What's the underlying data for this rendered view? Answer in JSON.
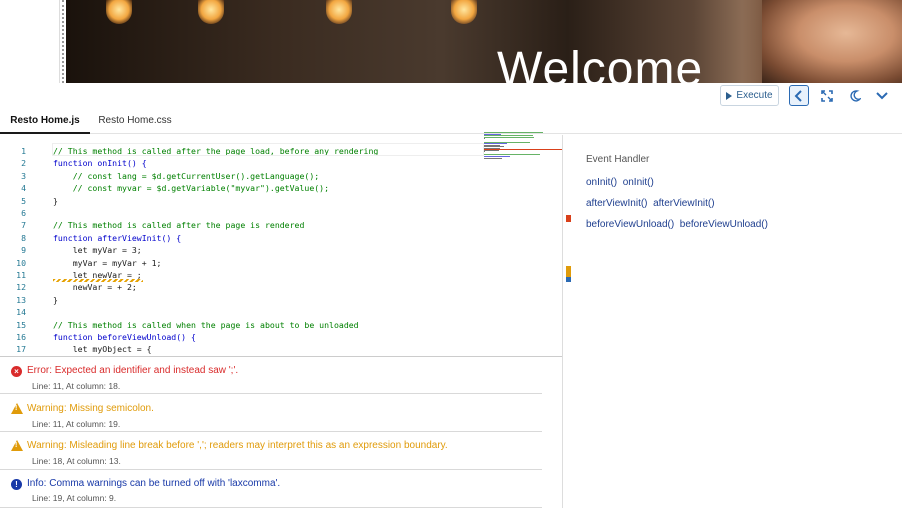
{
  "hero": {
    "title": "Welcome"
  },
  "toolbar": {
    "execute_label": "Execute",
    "icons": [
      "play-icon",
      "chevron-left-icon",
      "expand-icon",
      "moon-icon",
      "chevron-down-icon"
    ]
  },
  "tabs": [
    {
      "label": "Resto Home.js",
      "active": true
    },
    {
      "label": "Resto Home.css",
      "active": false
    }
  ],
  "code": {
    "lines": [
      {
        "n": "1",
        "text": "// This method is called after the page load, before any rendering",
        "color": "#008000"
      },
      {
        "n": "2",
        "text": "function onInit() {",
        "color": "#0000cc"
      },
      {
        "n": "3",
        "text": "    // const lang = $d.getCurrentUser().getLanguage();",
        "color": "#008000"
      },
      {
        "n": "4",
        "text": "    // const myvar = $d.getVariable(\"myvar\").getValue();",
        "color": "#008000"
      },
      {
        "n": "5",
        "text": "}",
        "color": "#1a1a1a"
      },
      {
        "n": "6",
        "text": "",
        "color": "#1a1a1a"
      },
      {
        "n": "7",
        "text": "// This method is called after the page is rendered",
        "color": "#008000"
      },
      {
        "n": "8",
        "text": "function afterViewInit() {",
        "color": "#0000cc"
      },
      {
        "n": "9",
        "text": "    let myVar = 3;",
        "color": "#1a1a1a"
      },
      {
        "n": "10",
        "text": "    myVar = myVar + 1;",
        "color": "#1a1a1a"
      },
      {
        "n": "11",
        "text": "    let newVar = ;",
        "color": "#1a1a1a"
      },
      {
        "n": "12",
        "text": "    newVar = + 2;",
        "color": "#1a1a1a"
      },
      {
        "n": "13",
        "text": "}",
        "color": "#1a1a1a"
      },
      {
        "n": "14",
        "text": "",
        "color": "#1a1a1a"
      },
      {
        "n": "15",
        "text": "// This method is called when the page is about to be unloaded",
        "color": "#008000"
      },
      {
        "n": "16",
        "text": "function beforeViewUnload() {",
        "color": "#0000cc"
      },
      {
        "n": "17",
        "text": "    let myObject = {",
        "color": "#1a1a1a"
      }
    ]
  },
  "event_panel": {
    "title": "Event Handler",
    "items": [
      {
        "event": "onInit()",
        "handler": "onInit()"
      },
      {
        "event": "afterViewInit()",
        "handler": "afterViewInit()"
      },
      {
        "event": "beforeViewUnload()",
        "handler": "beforeViewUnload()"
      }
    ]
  },
  "problems": [
    {
      "severity": "error",
      "message": "Error: Expected an identifier and instead saw ';'.",
      "detail": "Line: 11, At column: 18.",
      "color": "#d92b2b"
    },
    {
      "severity": "warning",
      "message": "Warning: Missing semicolon.",
      "detail": "Line: 11, At column: 19.",
      "color": "#e09b0a"
    },
    {
      "severity": "warning",
      "message": "Warning: Misleading line break before ','; readers may interpret this as an expression boundary.",
      "detail": "Line: 18, At column: 13.",
      "color": "#e09b0a"
    },
    {
      "severity": "info",
      "message": "Info: Comma warnings can be turned off with 'laxcomma'.",
      "detail": "Line: 19, At column: 9.",
      "color": "#1839a8"
    }
  ]
}
